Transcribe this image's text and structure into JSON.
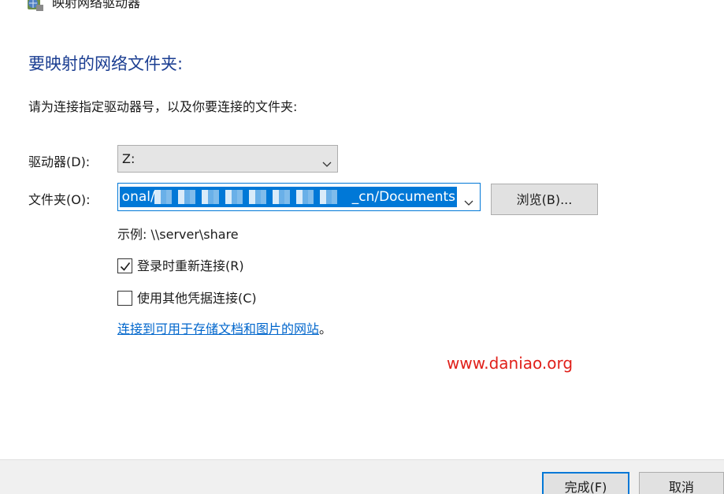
{
  "window": {
    "title": "映射网络驱动器"
  },
  "main": {
    "heading": "要映射的网络文件夹:",
    "instruction": "请为连接指定驱动器号，以及你要连接的文件夹:"
  },
  "drive": {
    "label": "驱动器(D):",
    "value": "Z:"
  },
  "folder": {
    "label": "文件夹(O):",
    "value_start": "onal/",
    "value_end": "_cn/Documents",
    "browse_label": "浏览(B)..."
  },
  "example": "示例: \\\\server\\share",
  "options": {
    "reconnect_label": "登录时重新连接(R)",
    "reconnect_checked": true,
    "credentials_label": "使用其他凭据连接(C)",
    "credentials_checked": false
  },
  "link": {
    "text": "连接到可用于存储文档和图片的网站",
    "suffix": "。"
  },
  "watermark": "www.daniao.org",
  "footer": {
    "finish_label": "完成(F)",
    "cancel_label": "取消"
  },
  "colors": {
    "heading": "#1a3d91",
    "accent": "#0078d7",
    "link": "#0066cc",
    "watermark": "#e0201a"
  },
  "icons": {
    "title": "network-drive-icon",
    "dropdown": "chevron-down-icon",
    "check": "check-icon"
  }
}
